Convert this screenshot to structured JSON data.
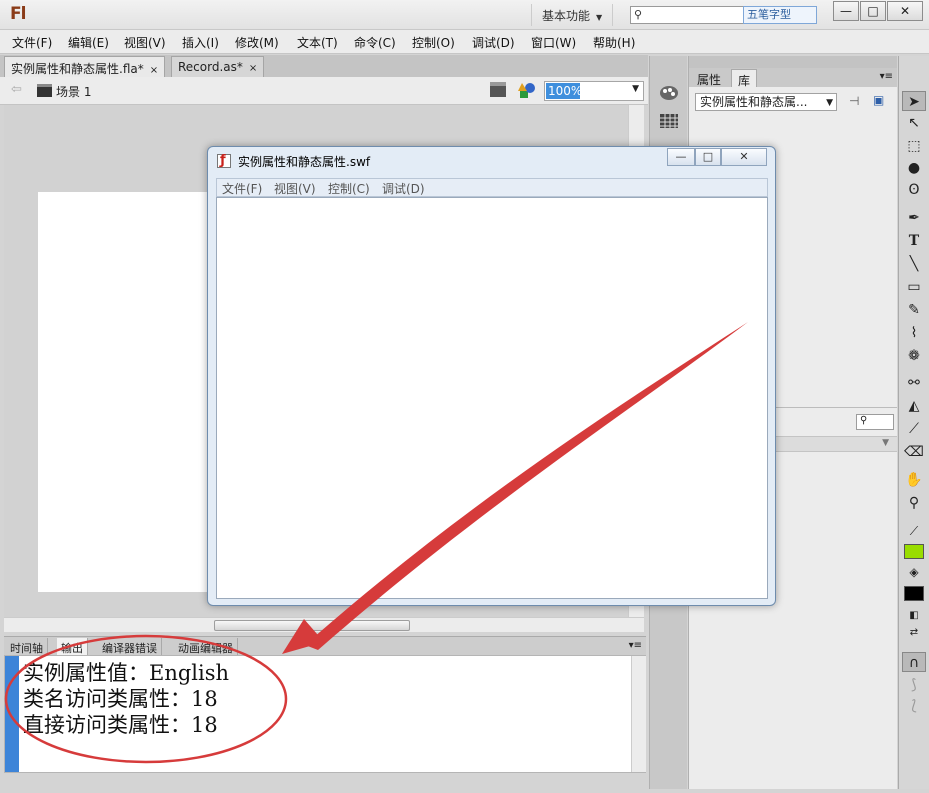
{
  "app": {
    "logo": "Fl",
    "workspace": "基本功能"
  },
  "window_controls": {
    "minimize": "—",
    "maximize": "□",
    "close": "✕"
  },
  "ime_badge": "五笔字型",
  "menu": [
    "文件(F)",
    "编辑(E)",
    "视图(V)",
    "插入(I)",
    "修改(M)",
    "文本(T)",
    "命令(C)",
    "控制(O)",
    "调试(D)",
    "窗口(W)",
    "帮助(H)"
  ],
  "doc_tabs": [
    {
      "label": "实例属性和静态属性.fla*",
      "close": "×"
    },
    {
      "label": "Record.as*",
      "close": "×"
    }
  ],
  "scene": {
    "label": "场景 1",
    "zoom": "100%"
  },
  "swf_window": {
    "title": "实例属性和静态属性.swf",
    "menu": [
      "文件(F)",
      "视图(V)",
      "控制(C)",
      "调试(D)"
    ]
  },
  "panel_tabs": [
    "时间轴",
    "输出",
    "编译器错误",
    "动画编辑器"
  ],
  "output_lines": [
    "实例属性值：English",
    "类名访问类属性：18",
    "直接访问类属性：18"
  ],
  "right_panel": {
    "tabs": [
      "属性",
      "库"
    ],
    "library_select": "实例属性和静态属..."
  },
  "colors": {
    "stroke_swatch": "#99dd00",
    "fill_swatch": "#000000",
    "annotation": "#d63b3b"
  }
}
